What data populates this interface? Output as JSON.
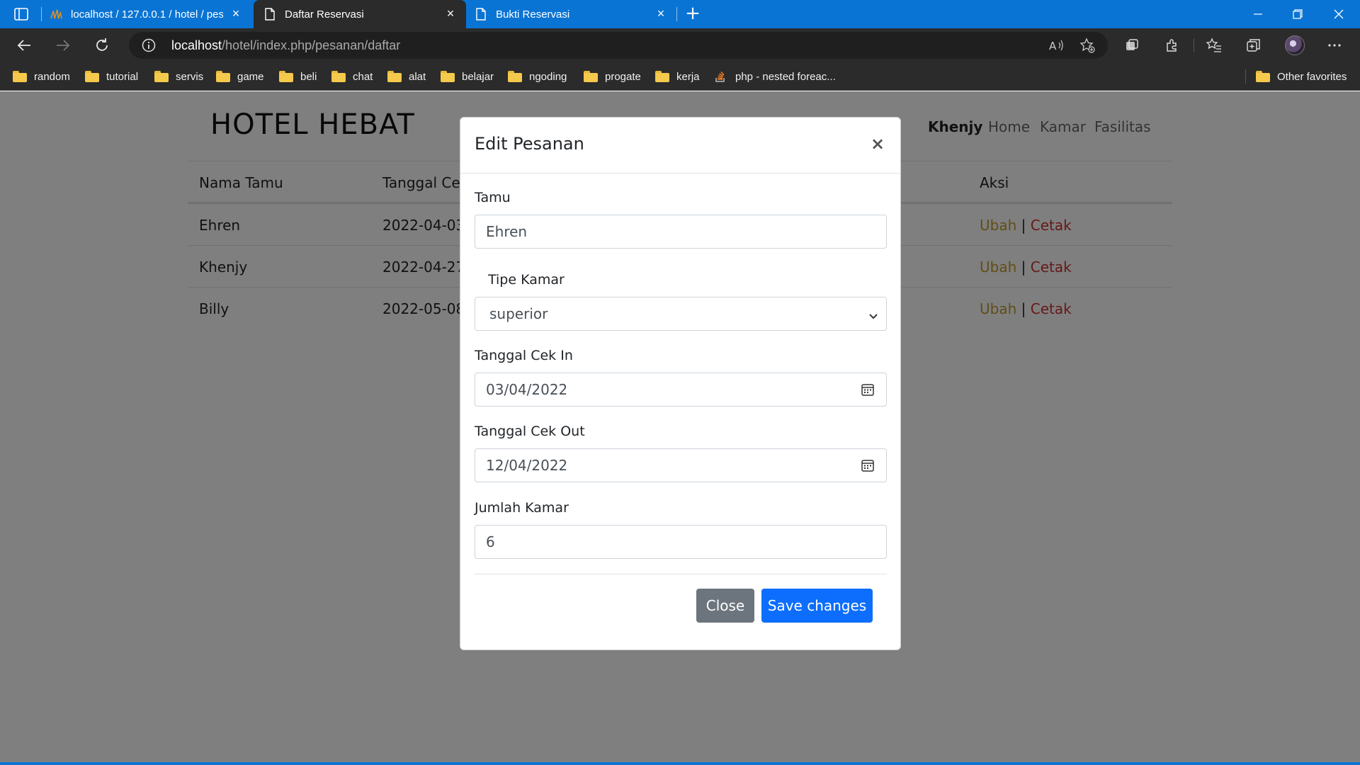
{
  "browser": {
    "tabs": [
      {
        "title": "localhost / 127.0.0.1 / hotel / pesanan",
        "icon": "phpmyadmin-icon",
        "active": false
      },
      {
        "title": "Daftar Reservasi",
        "icon": "page-icon",
        "active": true
      },
      {
        "title": "Bukti Reservasi",
        "icon": "page-icon",
        "active": false
      }
    ],
    "address": {
      "host": "localhost",
      "path": "/hotel/index.php/pesanan/daftar"
    },
    "bookmarks": [
      {
        "label": "random",
        "icon": "folder-icon"
      },
      {
        "label": "tutorial",
        "icon": "folder-icon"
      },
      {
        "label": "servis",
        "icon": "folder-icon"
      },
      {
        "label": "game",
        "icon": "folder-icon"
      },
      {
        "label": "beli",
        "icon": "folder-icon"
      },
      {
        "label": "chat",
        "icon": "folder-icon"
      },
      {
        "label": "alat",
        "icon": "folder-icon"
      },
      {
        "label": "belajar",
        "icon": "folder-icon"
      },
      {
        "label": "ngoding",
        "icon": "folder-icon"
      },
      {
        "label": "progate",
        "icon": "folder-icon"
      },
      {
        "label": "kerja",
        "icon": "folder-icon"
      },
      {
        "label": "php - nested foreac...",
        "icon": "stackoverflow-icon"
      }
    ],
    "other_favorites": "Other favorites"
  },
  "page": {
    "brand": "HOTEL HEBAT",
    "nav": {
      "user": "Khenjy",
      "home": "Home",
      "kamar": "Kamar",
      "fasilitas": "Fasilitas"
    },
    "table": {
      "headers": {
        "nama": "Nama Tamu",
        "tanggal": "Tanggal Cek",
        "aksi": "Aksi"
      },
      "rows": [
        {
          "nama": "Ehren",
          "tanggal": "2022-04-03",
          "ubah": "Ubah",
          "sep": "|",
          "cetak": "Cetak"
        },
        {
          "nama": "Khenjy",
          "tanggal": "2022-04-27",
          "ubah": "Ubah",
          "sep": "|",
          "cetak": "Cetak"
        },
        {
          "nama": "Billy",
          "tanggal": "2022-05-08",
          "ubah": "Ubah",
          "sep": "|",
          "cetak": "Cetak"
        }
      ]
    }
  },
  "modal": {
    "title": "Edit Pesanan",
    "close_x": "×",
    "fields": {
      "tamu": {
        "label": "Tamu",
        "value": "Ehren"
      },
      "tipe_kamar": {
        "label": "Tipe Kamar",
        "value": "superior"
      },
      "cek_in": {
        "label": "Tanggal Cek In",
        "value": "03/04/2022"
      },
      "cek_out": {
        "label": "Tanggal Cek Out",
        "value": "12/04/2022"
      },
      "jumlah": {
        "label": "Jumlah Kamar",
        "value": "6"
      }
    },
    "buttons": {
      "close": "Close",
      "save": "Save changes"
    }
  },
  "colors": {
    "titlebar": "#0a74d4",
    "chrome": "#2b2b2b",
    "ubah_link": "#c29a2c",
    "cetak_link": "#cc3333",
    "btn_secondary": "#6c757d",
    "btn_primary": "#0d6efd"
  }
}
